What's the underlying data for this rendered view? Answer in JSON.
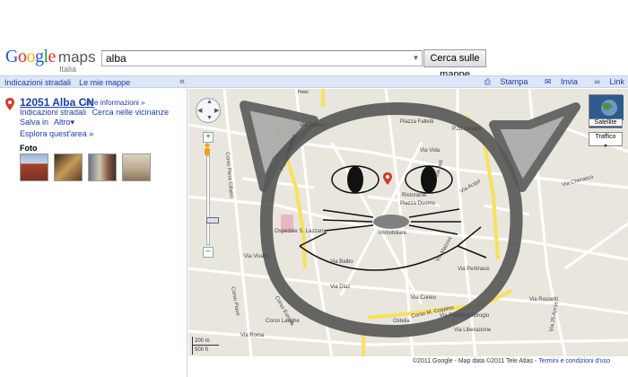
{
  "header": {
    "logo_google": "Google",
    "logo_maps": "maps",
    "logo_country": "Italia",
    "search_value": "alba",
    "search_button": "Cerca sulle mappe"
  },
  "topbar": {
    "left_links": [
      "Indicazioni stradali",
      "Le mie mappe"
    ],
    "collapse": "«",
    "right_links": [
      "Stampa",
      "Invia",
      "Link"
    ]
  },
  "result": {
    "title": "12051 Alba CN",
    "more_info": "- altre informazioni »",
    "links": [
      "Indicazioni stradali",
      "Cerca nelle vicinanze",
      "Salva in",
      "Altro▾"
    ],
    "explore": "Esplora quest'area »",
    "foto_label": "Foto"
  },
  "map": {
    "satellite": "Satellite",
    "traffic": "Traffico",
    "scale_top": "200 m",
    "scale_bottom": "500 ft",
    "labels": {
      "piazza_medford": "Piazza Medford",
      "via_cavour": "Via Cavour",
      "piazza_falletti": "Piazza Falletti",
      "via_vida": "Via Vida",
      "ristorante": "Ristorante",
      "piazza_duomo": "Piazza Duomo",
      "via_acqui": "Via Acqui",
      "via_cherasca": "Via Cherasca",
      "corso_coppino": "Corso M. Coppino",
      "via_liberazione": "Via Liberazione",
      "via_pertinace": "Via Pertinace",
      "corso_piave": "Corso Piave",
      "corso_europa": "Corso Europa",
      "corso_langhe": "Corso Langhe",
      "via_mazzini": "Via Mazzini",
      "via_balbo": "Via Balbo",
      "via_diaz": "Via Diaz",
      "via_cuneo": "Via Cuneo",
      "via_roma": "Via Roma",
      "via_asti": "Via Asti",
      "via_rossetti": "Via Rossetti",
      "via_25_aprile": "Via 25 Aprile",
      "via_fratelli_ambrogio": "Via Fratelli Ambrogio",
      "ostelia": "Ostelia",
      "immobiliare": "Immobiliare",
      "ospedale": "Ospedale S. Lazzaro",
      "piazza_cesare": "P.zo Cesare",
      "via_vivaro": "Via Vivaro",
      "corso_piera": "Corso Piera Cillario"
    },
    "footer_copyright": "©2011 Google - Map data ©2011 Tele Atlas - ",
    "footer_terms": "Termini e condizioni d'uso"
  },
  "colors": {
    "link": "#1a3da8",
    "topbar_bg": "#dde6f6",
    "map_bg": "#e9e6de",
    "major_road": "#f8e15a",
    "drawing": "#5a5a5a"
  }
}
